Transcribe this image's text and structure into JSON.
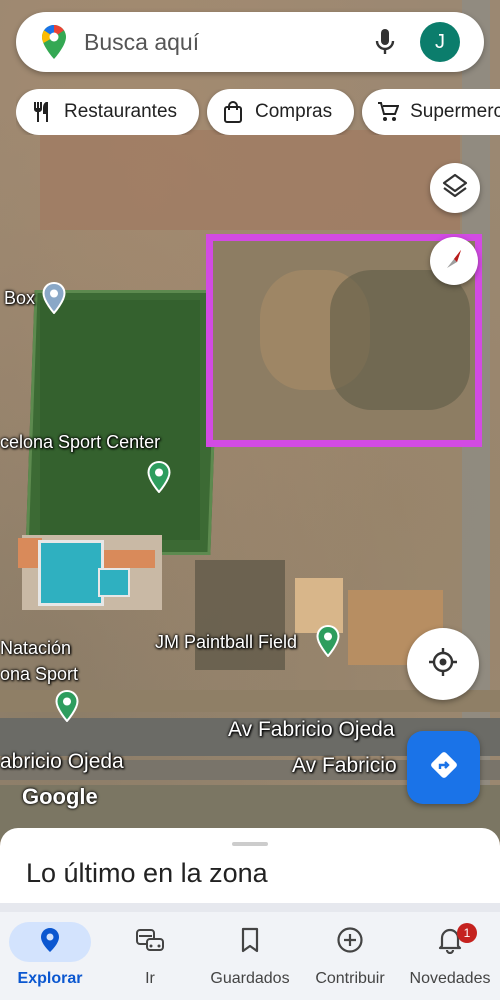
{
  "search": {
    "placeholder": "Busca aquí",
    "avatar_initial": "J"
  },
  "chips": [
    {
      "label": "Restaurantes",
      "icon": "restaurant-icon"
    },
    {
      "label": "Compras",
      "icon": "shopping-bag-icon"
    },
    {
      "label": "Supermercados",
      "icon": "cart-icon"
    }
  ],
  "map": {
    "labels": {
      "box": "Box",
      "sport_center": "celona Sport Center",
      "natacion": "Natación",
      "ona_sport": "ona Sport",
      "paintball": "JM Paintball Field"
    },
    "roads": {
      "road1": "Av Fabricio Ojeda",
      "road2": "abricio Ojeda",
      "road3": "Av Fabricio"
    },
    "attribution": "Google",
    "highlight_color": "#d24be3"
  },
  "sheet": {
    "title": "Lo último en la zona"
  },
  "nav": [
    {
      "label": "Explorar",
      "icon": "explore-pin-icon",
      "active": true
    },
    {
      "label": "Ir",
      "icon": "commute-icon"
    },
    {
      "label": "Guardados",
      "icon": "bookmark-icon"
    },
    {
      "label": "Contribuir",
      "icon": "add-circle-icon"
    },
    {
      "label": "Novedades",
      "icon": "bell-icon",
      "badge": "1"
    }
  ],
  "colors": {
    "accent": "#1a73e8",
    "active_nav": "#0b57d0",
    "badge": "#c5221f"
  }
}
